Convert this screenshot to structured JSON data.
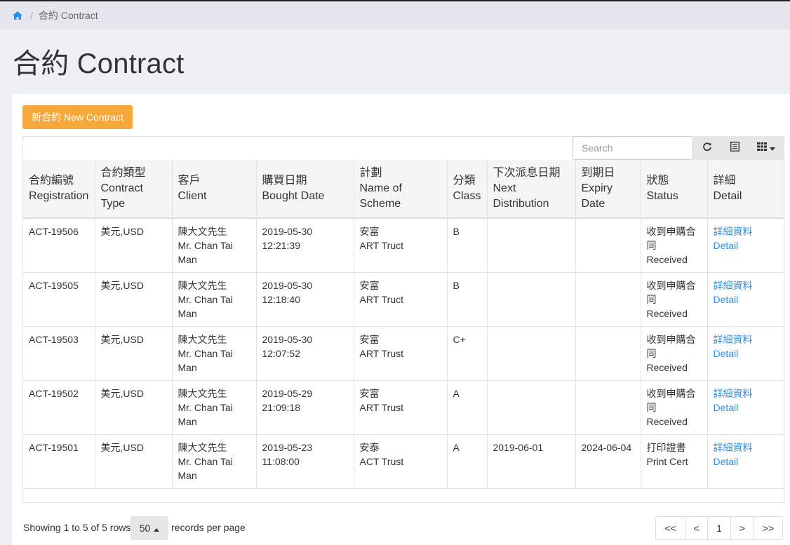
{
  "breadcrumb": {
    "home_icon": "home-icon",
    "current": "合約 Contract"
  },
  "page": {
    "title": "合約 Contract"
  },
  "toolbar": {
    "new_contract_label": "新合約 New Contract",
    "search_placeholder": "Search",
    "refresh_icon": "refresh-icon",
    "toggle_view_icon": "list-view-icon",
    "columns_icon": "columns-grid-icon"
  },
  "table": {
    "headers": [
      {
        "zh": "合約編號",
        "en": "Registration"
      },
      {
        "zh": "合約類型",
        "en": "Contract Type"
      },
      {
        "zh": "客戶",
        "en": "Client"
      },
      {
        "zh": "購買日期",
        "en": "Bought Date"
      },
      {
        "zh": "計劃",
        "en": "Name of Scheme"
      },
      {
        "zh": "分類",
        "en": "Class"
      },
      {
        "zh": "下次派息日期",
        "en": "Next Distribution"
      },
      {
        "zh": "到期日",
        "en": "Expiry Date"
      },
      {
        "zh": "狀態",
        "en": "Status"
      },
      {
        "zh": "詳細",
        "en": "Detail"
      }
    ],
    "rows": [
      {
        "registration": "ACT-19506",
        "type": "美元,USD",
        "client_zh": "陳大文先生",
        "client_en": "Mr. Chan Tai Man",
        "date": "2019-05-30",
        "time": "12:21:39",
        "scheme_zh": "安富",
        "scheme_en": "ART Truct",
        "class": "B",
        "next": "",
        "expiry": "",
        "status_zh": "收到申購合同",
        "status_en": "Received",
        "detail_zh": "詳細資料",
        "detail_en": "Detail"
      },
      {
        "registration": "ACT-19505",
        "type": "美元,USD",
        "client_zh": "陳大文先生",
        "client_en": "Mr. Chan Tai Man",
        "date": "2019-05-30",
        "time": "12:18:40",
        "scheme_zh": "安富",
        "scheme_en": "ART Truct",
        "class": "B",
        "next": "",
        "expiry": "",
        "status_zh": "收到申購合同",
        "status_en": "Received",
        "detail_zh": "詳細資料",
        "detail_en": "Detail"
      },
      {
        "registration": "ACT-19503",
        "type": "美元,USD",
        "client_zh": "陳大文先生",
        "client_en": "Mr. Chan Tai Man",
        "date": "2019-05-30",
        "time": "12:07:52",
        "scheme_zh": "安富",
        "scheme_en": "ART Trust",
        "class": "C+",
        "next": "",
        "expiry": "",
        "status_zh": "收到申購合同",
        "status_en": "Received",
        "detail_zh": "詳細資料",
        "detail_en": "Detail"
      },
      {
        "registration": "ACT-19502",
        "type": "美元,USD",
        "client_zh": "陳大文先生",
        "client_en": "Mr. Chan Tai Man",
        "date": "2019-05-29",
        "time": "21:09:18",
        "scheme_zh": "安富",
        "scheme_en": "ART Trust",
        "class": "A",
        "next": "",
        "expiry": "",
        "status_zh": "收到申購合同",
        "status_en": "Received",
        "detail_zh": "詳細資料",
        "detail_en": "Detail"
      },
      {
        "registration": "ACT-19501",
        "type": "美元,USD",
        "client_zh": "陳大文先生",
        "client_en": "Mr. Chan Tai Man",
        "date": "2019-05-23",
        "time": "11:08:00",
        "scheme_zh": "安泰",
        "scheme_en": "ACT Trust",
        "class": "A",
        "next": "2019-06-01",
        "expiry": "2024-06-04",
        "status_zh": "打印證書",
        "status_en": "Print Cert",
        "detail_zh": "詳細資料",
        "detail_en": "Detail"
      }
    ]
  },
  "footer": {
    "showing": "Showing 1 to 5 of 5 rows",
    "page_size": "50",
    "records_per_page": "records per page",
    "pager": [
      "<<",
      "<",
      "1",
      ">",
      ">>"
    ]
  },
  "colors": {
    "accent": "#f7a83a",
    "link": "#2a8fe8"
  }
}
